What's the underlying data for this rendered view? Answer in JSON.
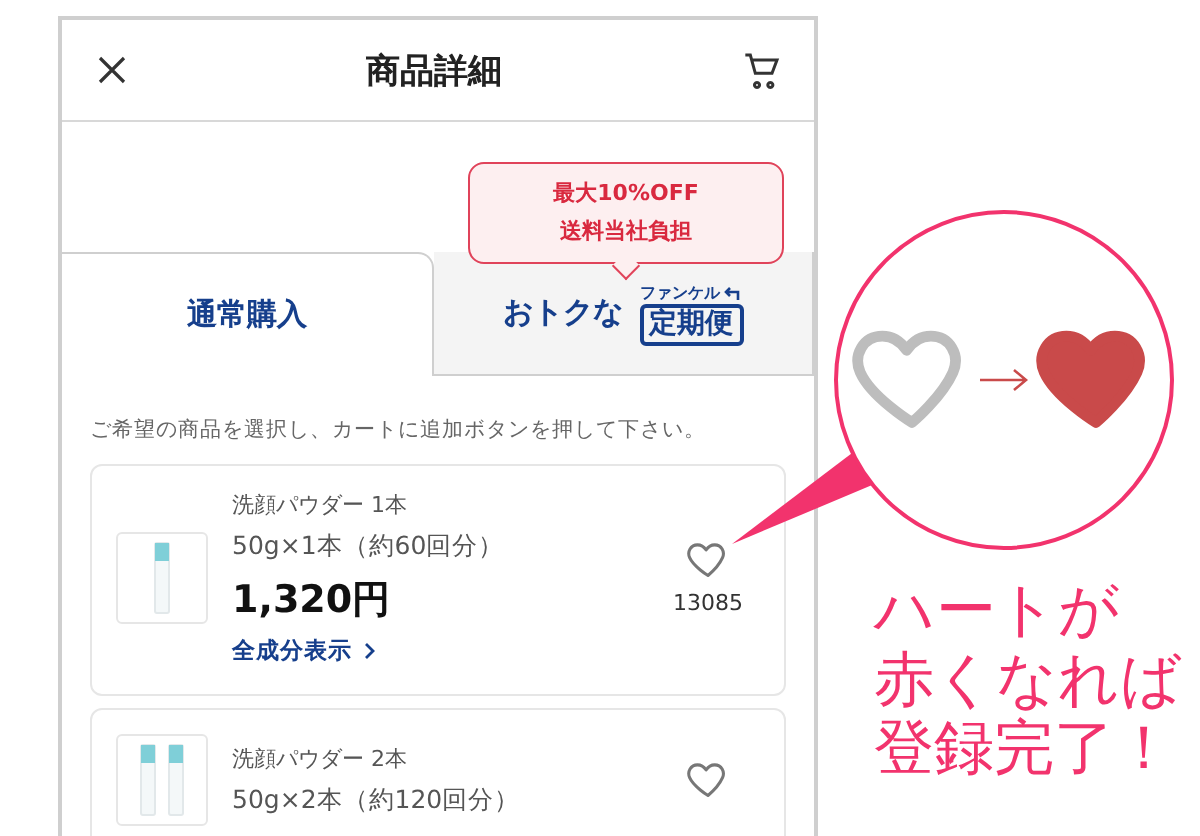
{
  "header": {
    "title": "商品詳細"
  },
  "promo": {
    "lines": [
      "最大10%OFF",
      "送料当社負担"
    ]
  },
  "tabs": [
    {
      "kind": "plain",
      "label": "通常購入",
      "selected": true
    },
    {
      "kind": "subscription",
      "label": "おトクな",
      "brand": "ファンケル",
      "badge": "定期便",
      "selected": false
    }
  ],
  "instruction": "ご希望の商品を選択し、カートに追加ボタンを押して下さい。",
  "products": [
    {
      "name": "洗顔パウダー 1本",
      "spec": "50g×1本（約60回分）",
      "price": "1,320円",
      "link": "全成分表示",
      "kind": "single",
      "liked": false,
      "count": "13085"
    },
    {
      "name": "洗顔パウダー 2本",
      "spec": "50g×2本（約120回分）",
      "kind": "double",
      "liked": false
    }
  ],
  "annotation": {
    "hearts": [
      {
        "liked": false
      },
      {
        "liked": true
      }
    ],
    "caption": [
      "ハートが",
      "赤くなれば",
      "登録完了！"
    ]
  }
}
